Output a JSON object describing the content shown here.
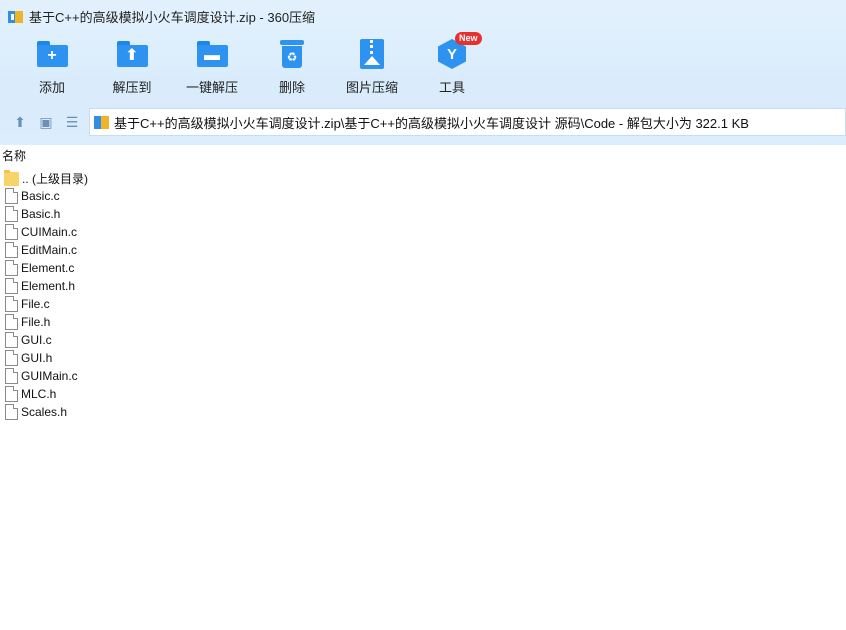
{
  "window": {
    "title": "基于C++的高级模拟小火车调度设计.zip - 360压缩"
  },
  "toolbar": {
    "items": [
      {
        "label": "添加",
        "icon": "add-folder-icon"
      },
      {
        "label": "解压到",
        "icon": "extract-to-icon"
      },
      {
        "label": "一键解压",
        "icon": "one-click-extract-icon"
      },
      {
        "label": "删除",
        "icon": "delete-bin-icon"
      },
      {
        "label": "图片压缩",
        "icon": "image-compress-icon"
      },
      {
        "label": "工具",
        "icon": "tools-icon",
        "badge": "New"
      }
    ]
  },
  "navbar": {
    "path": "基于C++的高级模拟小火车调度设计.zip\\基于C++的高级模拟小火车调度设计 源码\\Code - 解包大小为 322.1 KB"
  },
  "list": {
    "column_name": "名称",
    "files": [
      {
        "name": ".. (上级目录)",
        "type": "folder"
      },
      {
        "name": "Basic.c",
        "type": "file"
      },
      {
        "name": "Basic.h",
        "type": "file"
      },
      {
        "name": "CUIMain.c",
        "type": "file"
      },
      {
        "name": "EditMain.c",
        "type": "file"
      },
      {
        "name": "Element.c",
        "type": "file"
      },
      {
        "name": "Element.h",
        "type": "file"
      },
      {
        "name": "File.c",
        "type": "file"
      },
      {
        "name": "File.h",
        "type": "file"
      },
      {
        "name": "GUI.c",
        "type": "file"
      },
      {
        "name": "GUI.h",
        "type": "file"
      },
      {
        "name": "GUIMain.c",
        "type": "file"
      },
      {
        "name": "MLC.h",
        "type": "file"
      },
      {
        "name": "Scales.h",
        "type": "file"
      }
    ]
  },
  "colors": {
    "accent": "#2e93f0",
    "header_bg": "#dcedfd",
    "badge": "#e8312f"
  }
}
